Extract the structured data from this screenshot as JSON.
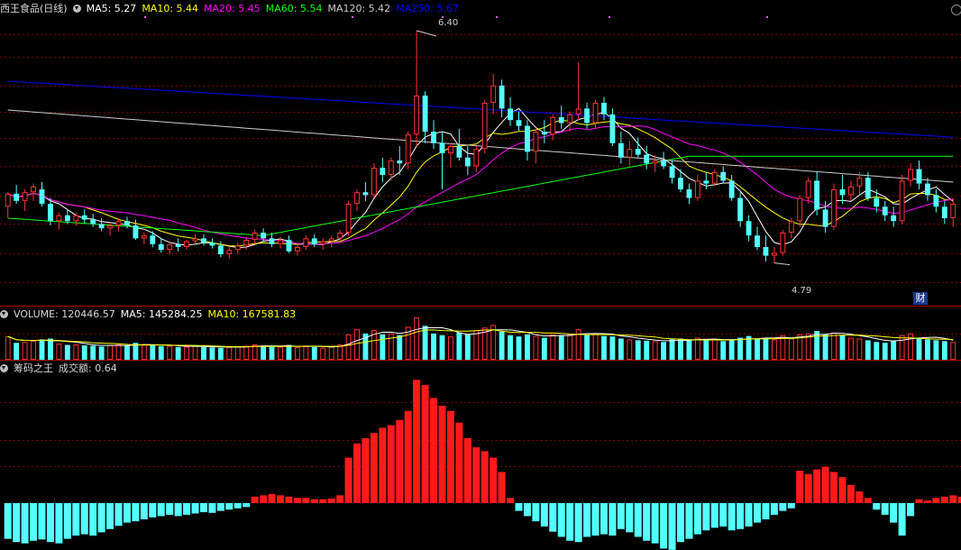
{
  "main": {
    "title": "西王食品(日线)",
    "ma": [
      {
        "label": "MA5: 5.27",
        "color": "#ffffff"
      },
      {
        "label": "MA10: 5.44",
        "color": "#ffff00"
      },
      {
        "label": "MA20: 5.45",
        "color": "#ff00ff"
      },
      {
        "label": "MA60: 5.54",
        "color": "#00ff00"
      },
      {
        "label": "MA120: 5.42",
        "color": "#cccccc"
      },
      {
        "label": "MA250: 5.67",
        "color": "#0000ff"
      }
    ],
    "high_label": "6.40",
    "low_label": "4.79",
    "cai": "财"
  },
  "volume_panel": {
    "label": "VOLUME: 120446.57",
    "ma5": "MA5: 145284.25",
    "ma10": "MA10: 167581.83"
  },
  "indicator_panel": {
    "name": "筹码之王",
    "value_label": "成交额: 0.64"
  },
  "colors": {
    "up": "#ff3333",
    "down": "#54ffff",
    "grid": "#7a0000",
    "bg": "#000000"
  },
  "chart_data": {
    "type": "candlestick",
    "price_range": [
      4.6,
      6.5
    ],
    "candles": [
      [
        5.18,
        5.28,
        5.1,
        5.27
      ],
      [
        5.27,
        5.33,
        5.2,
        5.22
      ],
      [
        5.22,
        5.3,
        5.15,
        5.28
      ],
      [
        5.28,
        5.34,
        5.22,
        5.32
      ],
      [
        5.3,
        5.35,
        5.18,
        5.2
      ],
      [
        5.2,
        5.24,
        5.05,
        5.08
      ],
      [
        5.08,
        5.14,
        5.02,
        5.12
      ],
      [
        5.12,
        5.16,
        5.06,
        5.08
      ],
      [
        5.08,
        5.14,
        5.05,
        5.12
      ],
      [
        5.12,
        5.16,
        5.06,
        5.09
      ],
      [
        5.09,
        5.13,
        5.04,
        5.06
      ],
      [
        5.06,
        5.1,
        5.01,
        5.03
      ],
      [
        5.03,
        5.07,
        4.98,
        5.05
      ],
      [
        5.05,
        5.1,
        5.01,
        5.08
      ],
      [
        5.08,
        5.11,
        5.03,
        5.05
      ],
      [
        5.05,
        5.09,
        4.95,
        4.96
      ],
      [
        4.96,
        5.0,
        4.92,
        4.98
      ],
      [
        4.98,
        5.01,
        4.9,
        4.92
      ],
      [
        4.92,
        4.96,
        4.86,
        4.88
      ],
      [
        4.88,
        4.94,
        4.85,
        4.92
      ],
      [
        4.92,
        4.96,
        4.87,
        4.9
      ],
      [
        4.9,
        4.95,
        4.88,
        4.94
      ],
      [
        4.94,
        4.99,
        4.91,
        4.96
      ],
      [
        4.96,
        4.99,
        4.91,
        4.93
      ],
      [
        4.93,
        4.96,
        4.89,
        4.91
      ],
      [
        4.91,
        4.94,
        4.83,
        4.85
      ],
      [
        4.85,
        4.9,
        4.82,
        4.88
      ],
      [
        4.88,
        4.93,
        4.85,
        4.91
      ],
      [
        4.91,
        4.97,
        4.88,
        4.95
      ],
      [
        4.95,
        5.02,
        4.92,
        5.0
      ],
      [
        5.0,
        5.03,
        4.94,
        4.96
      ],
      [
        4.96,
        5.0,
        4.9,
        4.92
      ],
      [
        4.92,
        4.97,
        4.89,
        4.95
      ],
      [
        4.95,
        4.98,
        4.86,
        4.87
      ],
      [
        4.87,
        4.92,
        4.84,
        4.9
      ],
      [
        4.9,
        4.98,
        4.88,
        4.96
      ],
      [
        4.96,
        4.99,
        4.9,
        4.92
      ],
      [
        4.92,
        4.96,
        4.88,
        4.94
      ],
      [
        4.94,
        4.98,
        4.9,
        4.96
      ],
      [
        4.96,
        5.02,
        4.93,
        5.0
      ],
      [
        5.0,
        5.22,
        4.98,
        5.2
      ],
      [
        5.2,
        5.3,
        5.15,
        5.28
      ],
      [
        5.28,
        5.35,
        5.22,
        5.26
      ],
      [
        5.26,
        5.48,
        5.24,
        5.45
      ],
      [
        5.45,
        5.52,
        5.35,
        5.4
      ],
      [
        5.4,
        5.52,
        5.36,
        5.5
      ],
      [
        5.5,
        5.6,
        5.4,
        5.48
      ],
      [
        5.48,
        5.7,
        5.44,
        5.68
      ],
      [
        5.68,
        6.4,
        5.6,
        5.95
      ],
      [
        5.95,
        5.98,
        5.62,
        5.7
      ],
      [
        5.7,
        5.78,
        5.58,
        5.62
      ],
      [
        5.62,
        5.7,
        5.3,
        5.55
      ],
      [
        5.55,
        5.62,
        5.45,
        5.6
      ],
      [
        5.6,
        5.72,
        5.5,
        5.52
      ],
      [
        5.52,
        5.6,
        5.4,
        5.46
      ],
      [
        5.46,
        5.6,
        5.42,
        5.58
      ],
      [
        5.58,
        5.92,
        5.55,
        5.9
      ],
      [
        5.9,
        6.1,
        5.82,
        6.02
      ],
      [
        6.02,
        6.06,
        5.8,
        5.86
      ],
      [
        5.86,
        5.94,
        5.74,
        5.78
      ],
      [
        5.78,
        5.84,
        5.7,
        5.74
      ],
      [
        5.74,
        5.78,
        5.5,
        5.56
      ],
      [
        5.56,
        5.72,
        5.48,
        5.7
      ],
      [
        5.7,
        5.78,
        5.62,
        5.68
      ],
      [
        5.68,
        5.82,
        5.64,
        5.8
      ],
      [
        5.8,
        5.88,
        5.72,
        5.76
      ],
      [
        5.76,
        5.84,
        5.7,
        5.82
      ],
      [
        5.82,
        6.18,
        5.78,
        5.86
      ],
      [
        5.86,
        5.9,
        5.72,
        5.76
      ],
      [
        5.76,
        5.92,
        5.72,
        5.9
      ],
      [
        5.9,
        5.94,
        5.78,
        5.82
      ],
      [
        5.82,
        5.86,
        5.6,
        5.62
      ],
      [
        5.62,
        5.7,
        5.48,
        5.52
      ],
      [
        5.52,
        5.64,
        5.46,
        5.58
      ],
      [
        5.58,
        5.66,
        5.52,
        5.54
      ],
      [
        5.54,
        5.6,
        5.44,
        5.48
      ],
      [
        5.48,
        5.54,
        5.42,
        5.5
      ],
      [
        5.5,
        5.56,
        5.44,
        5.46
      ],
      [
        5.46,
        5.5,
        5.34,
        5.38
      ],
      [
        5.38,
        5.44,
        5.28,
        5.3
      ],
      [
        5.3,
        5.34,
        5.2,
        5.24
      ],
      [
        5.24,
        5.4,
        5.22,
        5.36
      ],
      [
        5.36,
        5.42,
        5.3,
        5.34
      ],
      [
        5.34,
        5.44,
        5.32,
        5.42
      ],
      [
        5.42,
        5.46,
        5.34,
        5.36
      ],
      [
        5.36,
        5.4,
        5.22,
        5.24
      ],
      [
        5.24,
        5.28,
        5.04,
        5.08
      ],
      [
        5.08,
        5.12,
        4.94,
        4.98
      ],
      [
        4.98,
        5.04,
        4.88,
        4.9
      ],
      [
        4.9,
        4.98,
        4.8,
        4.84
      ],
      [
        4.84,
        4.9,
        4.79,
        4.86
      ],
      [
        4.86,
        5.02,
        4.84,
        5.0
      ],
      [
        5.0,
        5.1,
        4.96,
        5.08
      ],
      [
        5.08,
        5.26,
        5.04,
        5.24
      ],
      [
        5.24,
        5.38,
        5.2,
        5.36
      ],
      [
        5.36,
        5.42,
        5.12,
        5.16
      ],
      [
        5.16,
        5.22,
        5.0,
        5.04
      ],
      [
        5.04,
        5.34,
        5.02,
        5.3
      ],
      [
        5.3,
        5.4,
        5.2,
        5.26
      ],
      [
        5.26,
        5.36,
        5.22,
        5.32
      ],
      [
        5.32,
        5.42,
        5.26,
        5.38
      ],
      [
        5.38,
        5.42,
        5.22,
        5.24
      ],
      [
        5.24,
        5.3,
        5.14,
        5.18
      ],
      [
        5.18,
        5.22,
        5.08,
        5.12
      ],
      [
        5.12,
        5.18,
        5.04,
        5.08
      ],
      [
        5.08,
        5.4,
        5.06,
        5.36
      ],
      [
        5.36,
        5.48,
        5.32,
        5.44
      ],
      [
        5.44,
        5.5,
        5.3,
        5.34
      ],
      [
        5.34,
        5.38,
        5.22,
        5.26
      ],
      [
        5.26,
        5.3,
        5.14,
        5.18
      ],
      [
        5.18,
        5.22,
        5.06,
        5.1
      ],
      [
        5.1,
        5.24,
        5.04,
        5.2
      ]
    ],
    "ma_series_close_based": [
      "MA5",
      "MA10",
      "MA20",
      "MA60",
      "MA120",
      "MA250"
    ],
    "volume": [
      0.55,
      0.4,
      0.42,
      0.45,
      0.48,
      0.5,
      0.38,
      0.35,
      0.36,
      0.34,
      0.33,
      0.31,
      0.35,
      0.36,
      0.33,
      0.4,
      0.36,
      0.34,
      0.32,
      0.33,
      0.3,
      0.31,
      0.33,
      0.3,
      0.29,
      0.28,
      0.3,
      0.32,
      0.33,
      0.36,
      0.33,
      0.3,
      0.31,
      0.35,
      0.3,
      0.32,
      0.3,
      0.28,
      0.31,
      0.36,
      0.6,
      0.72,
      0.62,
      0.7,
      0.6,
      0.62,
      0.58,
      0.78,
      1.0,
      0.8,
      0.62,
      0.58,
      0.55,
      0.64,
      0.6,
      0.7,
      0.76,
      0.82,
      0.66,
      0.58,
      0.55,
      0.6,
      0.56,
      0.52,
      0.6,
      0.58,
      0.6,
      0.72,
      0.58,
      0.62,
      0.56,
      0.55,
      0.5,
      0.48,
      0.46,
      0.45,
      0.44,
      0.42,
      0.48,
      0.5,
      0.46,
      0.52,
      0.46,
      0.5,
      0.44,
      0.46,
      0.52,
      0.56,
      0.5,
      0.52,
      0.48,
      0.58,
      0.5,
      0.6,
      0.62,
      0.68,
      0.6,
      0.64,
      0.58,
      0.52,
      0.5,
      0.46,
      0.42,
      0.4,
      0.44,
      0.58,
      0.62,
      0.52,
      0.48,
      0.46,
      0.44,
      0.42
    ],
    "indicator": [
      -0.55,
      -0.6,
      -0.62,
      -0.58,
      -0.56,
      -0.6,
      -0.62,
      -0.55,
      -0.5,
      -0.48,
      -0.5,
      -0.45,
      -0.4,
      -0.35,
      -0.3,
      -0.28,
      -0.25,
      -0.22,
      -0.2,
      -0.18,
      -0.2,
      -0.18,
      -0.16,
      -0.14,
      -0.15,
      -0.12,
      -0.1,
      -0.08,
      -0.06,
      0.1,
      0.12,
      0.14,
      0.12,
      0.1,
      0.08,
      0.08,
      0.06,
      0.06,
      0.07,
      0.12,
      0.7,
      0.92,
      1.0,
      1.08,
      1.16,
      1.2,
      1.28,
      1.42,
      1.9,
      1.82,
      1.62,
      1.5,
      1.42,
      1.24,
      1.0,
      0.86,
      0.8,
      0.7,
      0.48,
      0.08,
      -0.12,
      -0.2,
      -0.28,
      -0.36,
      -0.44,
      -0.52,
      -0.58,
      -0.6,
      -0.52,
      -0.5,
      -0.48,
      -0.5,
      -0.4,
      -0.45,
      -0.52,
      -0.58,
      -0.62,
      -0.7,
      -0.72,
      -0.6,
      -0.55,
      -0.48,
      -0.42,
      -0.38,
      -0.36,
      -0.42,
      -0.4,
      -0.36,
      -0.3,
      -0.25,
      -0.18,
      -0.12,
      -0.08,
      0.5,
      0.45,
      0.52,
      0.56,
      0.48,
      0.4,
      0.28,
      0.18,
      0.08,
      -0.1,
      -0.18,
      -0.3,
      -0.5,
      -0.2,
      0.06,
      0.04,
      0.08,
      0.1,
      0.12,
      0.1,
      0.08
    ]
  }
}
